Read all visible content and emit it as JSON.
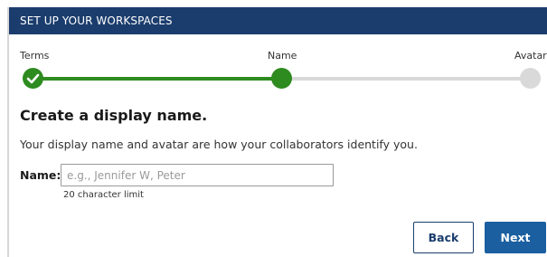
{
  "header": {
    "title": "SET UP YOUR WORKSPACES"
  },
  "steps": [
    {
      "label": "Terms",
      "status": "complete"
    },
    {
      "label": "Name",
      "status": "current"
    },
    {
      "label": "Avatar",
      "status": "upcoming"
    }
  ],
  "content": {
    "title": "Create a display name.",
    "description": "Your display name and avatar are how your collaborators identify you.",
    "name_label": "Name:",
    "name_value": "",
    "name_placeholder": "e.g., Jennifer W, Peter",
    "name_hint": "20 character limit"
  },
  "actions": {
    "back_label": "Back",
    "next_label": "Next"
  },
  "colors": {
    "header_bg": "#1b3d6d",
    "progress_done": "#2e8b1f",
    "progress_todo": "#d9d9d9",
    "primary_button": "#1b5fa0"
  }
}
